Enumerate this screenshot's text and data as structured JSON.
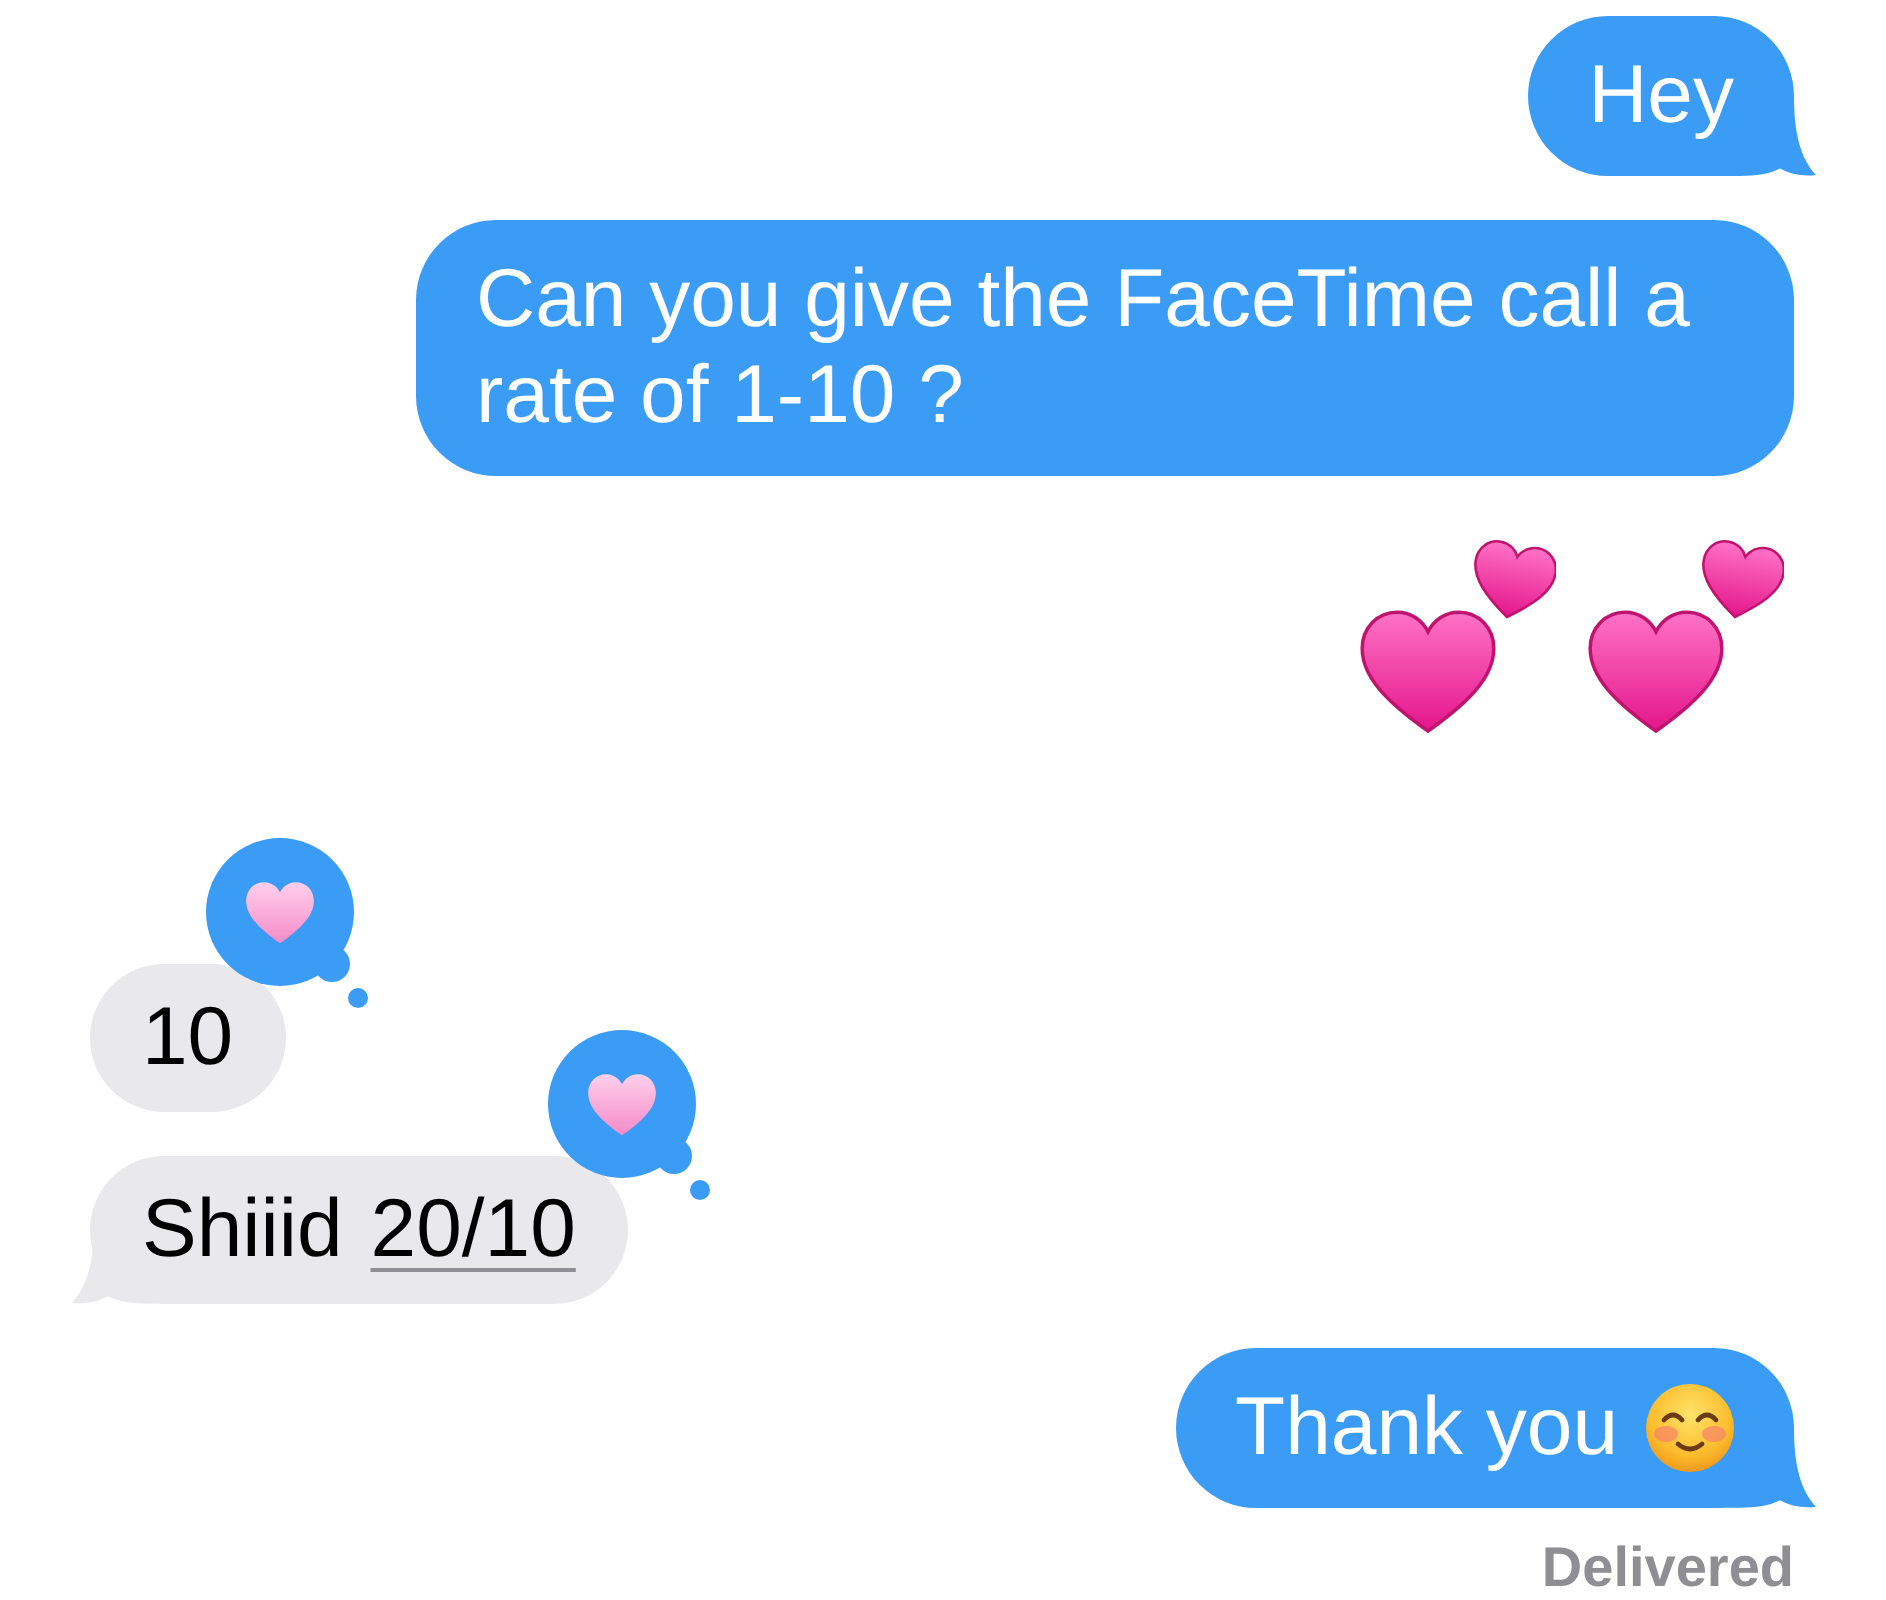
{
  "messages": [
    {
      "kind": "text",
      "outgoing": true,
      "text": "Hey",
      "tail": true,
      "tapback": false,
      "emoji": false
    },
    {
      "kind": "text",
      "outgoing": true,
      "text": "Can you give the FaceTime call a rate of 1-10 ?",
      "tail": false,
      "tapback": false,
      "emoji": false
    },
    {
      "kind": "hearts",
      "outgoing": true
    },
    {
      "kind": "text",
      "outgoing": false,
      "text": "10",
      "tail": false,
      "tapback": true,
      "emoji": false
    },
    {
      "kind": "text",
      "outgoing": false,
      "text": "Shiiid",
      "link": "20/10",
      "tail": true,
      "tapback": true,
      "emoji": false
    },
    {
      "kind": "text",
      "outgoing": true,
      "text": "Thank you",
      "tail": true,
      "tapback": false,
      "emoji": true
    }
  ],
  "status": "Delivered"
}
